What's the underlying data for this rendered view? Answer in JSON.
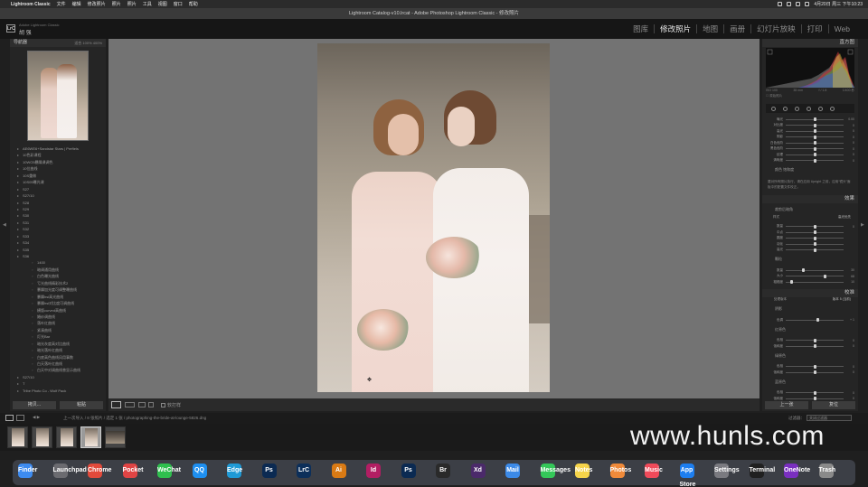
{
  "menubar": {
    "app": "Lightroom Classic",
    "items": [
      "文件",
      "编辑",
      "修改照片",
      "照片",
      "设置",
      "工具",
      "视图",
      "窗口",
      "帮助"
    ],
    "clock": "4月20日 周三 下午10:23"
  },
  "window_title": "Lightroom Catalog-v10.lrcat - Adobe Photoshop Lightroom Classic - 修改照片",
  "identity": {
    "logo": "LrC",
    "subtitle": "Adobe Lightroom Classic",
    "name": "胡 强"
  },
  "modules": [
    "图库",
    "修改照片",
    "地图",
    "画册",
    "幻灯片放映",
    "打印",
    "Web"
  ],
  "active_module": "修改照片",
  "navigator": {
    "title": "导航器",
    "zoom": "适合  100%  400%"
  },
  "collections": [
    {
      "label": "AE6WE6+Sandstar Stars | Preftels",
      "level": 1
    },
    {
      "label": "10色彩课程",
      "level": 1
    },
    {
      "label": "10WO5暴躁课调色",
      "level": 1
    },
    {
      "label": "10位曲线",
      "level": 1
    },
    {
      "label": "10S重做",
      "level": 1
    },
    {
      "label": "10S05曝光课",
      "level": 1
    },
    {
      "label": "S27",
      "level": 1
    },
    {
      "label": "S27/10",
      "level": 1
    },
    {
      "label": "S28",
      "level": 1
    },
    {
      "label": "S29",
      "level": 1
    },
    {
      "label": "S30",
      "level": 1
    },
    {
      "label": "S31",
      "level": 1
    },
    {
      "label": "S32",
      "level": 1
    },
    {
      "label": "S33",
      "level": 1
    },
    {
      "label": "S34",
      "level": 1
    },
    {
      "label": "S35",
      "level": 1
    },
    {
      "label": "S36",
      "level": 1
    },
    {
      "label": "1400",
      "level": 2
    },
    {
      "label": "暗调通用曲线",
      "level": 2
    },
    {
      "label": "白色曝光曲线",
      "level": 2
    },
    {
      "label": "亏光曲线精彩技术2",
      "level": 2
    },
    {
      "label": "暴躁加光度可调整曝曲线",
      "level": 2
    },
    {
      "label": "暴躁hsl高光曲线",
      "level": 2
    },
    {
      "label": "暴躁hsl对比度可调曲线",
      "level": 2
    },
    {
      "label": "横版curved高曲线",
      "level": 2
    },
    {
      "label": "婚纱调曲线",
      "level": 2
    },
    {
      "label": "落叶红曲线",
      "level": 2
    },
    {
      "label": "紧凑曲线",
      "level": 2
    },
    {
      "label": "灯光Bar",
      "level": 2
    },
    {
      "label": "暗光灰度高对比曲线",
      "level": 2
    },
    {
      "label": "暗光落叶红曲线",
      "level": 2
    },
    {
      "label": "白底高色曲线风用事数",
      "level": 2
    },
    {
      "label": "白天落叶红曲线",
      "level": 2
    },
    {
      "label": "白天中对调曲线曾显示曲线",
      "level": 2
    },
    {
      "label": "S27/10",
      "level": 1
    },
    {
      "label": "T",
      "level": 1
    },
    {
      "label": "Tribe Photo Co - Wolf Pack",
      "level": 1
    },
    {
      "label": "V2 Dark Warm (Lightroom)",
      "level": 1
    }
  ],
  "left_buttons": [
    "拷贝...",
    "粘贴"
  ],
  "toolbar": {
    "softproof": "软打样"
  },
  "right_panel": {
    "histogram_title": "直方图",
    "histo_info": [
      "ISO 100",
      "35 mm",
      "f / 1.8",
      "1/400 秒"
    ],
    "original": "原始照片",
    "basic_sliders": [
      {
        "label": "曝光",
        "value": "0.00",
        "pos": 0.5
      },
      {
        "label": "对比度",
        "value": "0",
        "pos": 0.5
      },
      {
        "label": "高光",
        "value": "0",
        "pos": 0.5
      },
      {
        "label": "阴影",
        "value": "0",
        "pos": 0.5
      },
      {
        "label": "白色色阶",
        "value": "0",
        "pos": 0.5
      },
      {
        "label": "黑色色阶",
        "value": "0",
        "pos": 0.5
      },
      {
        "label": "纹理",
        "value": "0",
        "pos": 0.5
      },
      {
        "label": "清晰度",
        "value": "0",
        "pos": 0.5
      }
    ],
    "note_title": "颜色  饱和度",
    "note": "要对所有照片执行，请在应用 Upright 之前，应用“镜头”面板中的配置文件校正。",
    "effects_title": "效果",
    "vignette_title": "裁剪后暗角",
    "vignette_style": "高光优先",
    "vignette_sliders": [
      {
        "label": "数量",
        "value": "0",
        "pos": 0.5
      },
      {
        "label": "中点",
        "value": "",
        "pos": 0.5
      },
      {
        "label": "圆度",
        "value": "",
        "pos": 0.5
      },
      {
        "label": "羽化",
        "value": "",
        "pos": 0.5
      },
      {
        "label": "高光",
        "value": "",
        "pos": 0.5
      }
    ],
    "grain_title": "颗粒",
    "grain_sliders": [
      {
        "label": "数量",
        "value": "30",
        "pos": 0.3
      },
      {
        "label": "大小",
        "value": "68",
        "pos": 0.68
      },
      {
        "label": "粗糙度",
        "value": "10",
        "pos": 0.1
      }
    ],
    "calibration_title": "校准",
    "process_label": "处理版本",
    "process_value": "版本 5 (当前)",
    "shadow_title": "阴影",
    "shadow_slider": {
      "label": "色调",
      "value": "+ 1",
      "pos": 0.55
    },
    "red_title": "红原色",
    "green_title": "绿原色",
    "blue_title": "蓝原色",
    "primary_sliders": [
      {
        "label": "色相",
        "value": "0",
        "pos": 0.5
      },
      {
        "label": "饱和度",
        "value": "0",
        "pos": 0.5
      }
    ],
    "buttons": [
      "上一张",
      "复位"
    ]
  },
  "filmbar": {
    "nav": "◀ ▶",
    "path": "上一次导入 / 8 张照片 / 选定 1 张 / photographing-the-bride-at-lounge-5826.dng",
    "filter_label": "过滤器：",
    "filter_value": "关闭过滤器"
  },
  "watermark": "www.hunls.com",
  "dock": {
    "icons": [
      "Finder",
      "Launchpad",
      "Chrome",
      "Pocket",
      "WeChat",
      "QQ",
      "Edge",
      "Ps",
      "LrC",
      "Ai",
      "Id",
      "Ps",
      "Br",
      "Xd",
      "Mail",
      "Messages",
      "Notes",
      "Photos",
      "Music",
      "App Store",
      "Settings",
      "Terminal",
      "OneNote",
      "Trash"
    ]
  }
}
